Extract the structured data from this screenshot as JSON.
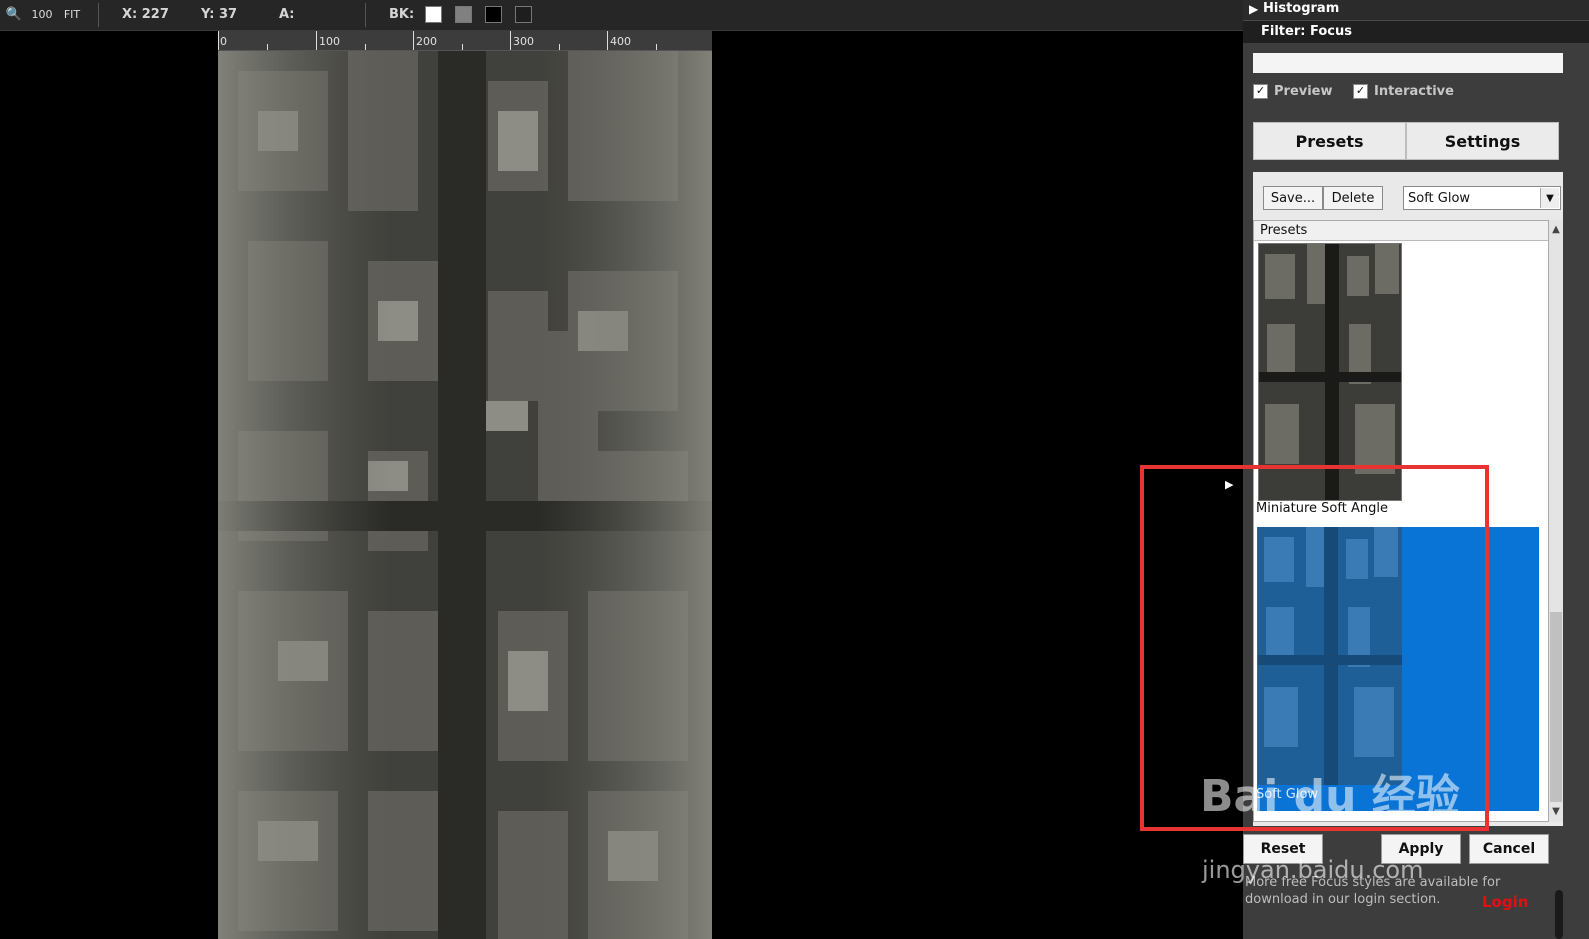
{
  "toolbar": {
    "zoom_100": "100",
    "zoom_fit": "FIT",
    "x_label": "X: 227",
    "y_label": "Y: 37",
    "a_label": "A:",
    "bk_label": "BK:",
    "bk_swatches": [
      "#ffffff",
      "#808080",
      "#000000",
      "#1e1e1e"
    ]
  },
  "ruler": {
    "labels": [
      "0",
      "100",
      "200",
      "300",
      "400"
    ]
  },
  "panel": {
    "histogram_label": "Histogram",
    "filter_label": "Filter: Focus",
    "preview_label": "Preview",
    "interactive_label": "Interactive",
    "tabs": {
      "presets": "Presets",
      "settings": "Settings"
    },
    "save_label": "Save...",
    "delete_label": "Delete",
    "preset_selected": "Soft Glow",
    "list_header": "Presets",
    "items": [
      {
        "label": "Miniature Soft Angle"
      },
      {
        "label": "Soft Glow"
      }
    ],
    "reset_label": "Reset",
    "apply_label": "Apply",
    "cancel_label": "Cancel",
    "info_text": "More free Focus styles are available for download in our login section.",
    "login_label": "Login"
  },
  "watermark": {
    "brand": "Bai du 经验",
    "url": "jingyan.baidu.com"
  },
  "colors": {
    "selection": "#0a74d6",
    "highlight": "#e83333",
    "login": "#e01010"
  }
}
